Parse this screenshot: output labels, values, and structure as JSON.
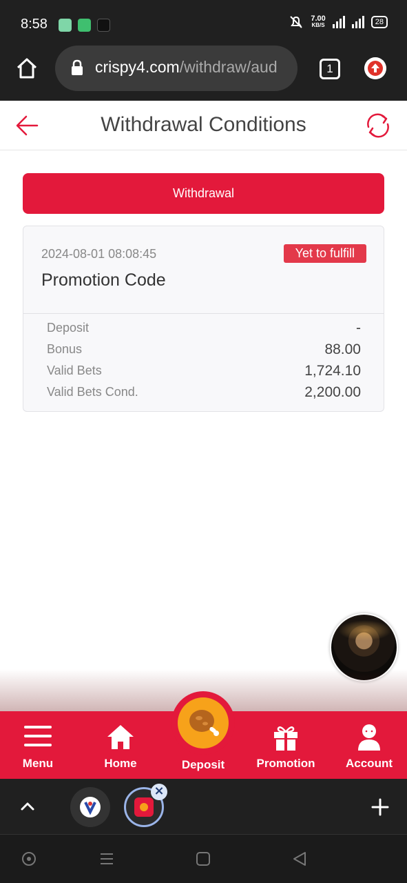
{
  "status_bar": {
    "time": "8:58",
    "net_speed": "7.00",
    "net_unit": "KB/S",
    "battery": "28"
  },
  "browser": {
    "url_domain": "crispy4.com",
    "url_path": "/withdraw/aud",
    "tab_count": "1"
  },
  "header": {
    "title": "Withdrawal Conditions"
  },
  "withdraw_button": "Withdrawal",
  "record": {
    "date": "2024-08-01 08:08:45",
    "status": "Yet to fulfill",
    "name": "Promotion Code",
    "rows": [
      {
        "label": "Deposit",
        "value": "-"
      },
      {
        "label": "Bonus",
        "value": "88.00"
      },
      {
        "label": "Valid Bets",
        "value": "1,724.10"
      },
      {
        "label": "Valid Bets Cond.",
        "value": "2,200.00"
      }
    ]
  },
  "bottom_nav": {
    "menu": "Menu",
    "home": "Home",
    "deposit": "Deposit",
    "promotion": "Promotion",
    "account": "Account"
  },
  "colors": {
    "brand_red": "#e3193b",
    "badge_red": "#e3394a",
    "deposit_orange": "#f7a21a",
    "chrome_dark": "#202020"
  }
}
